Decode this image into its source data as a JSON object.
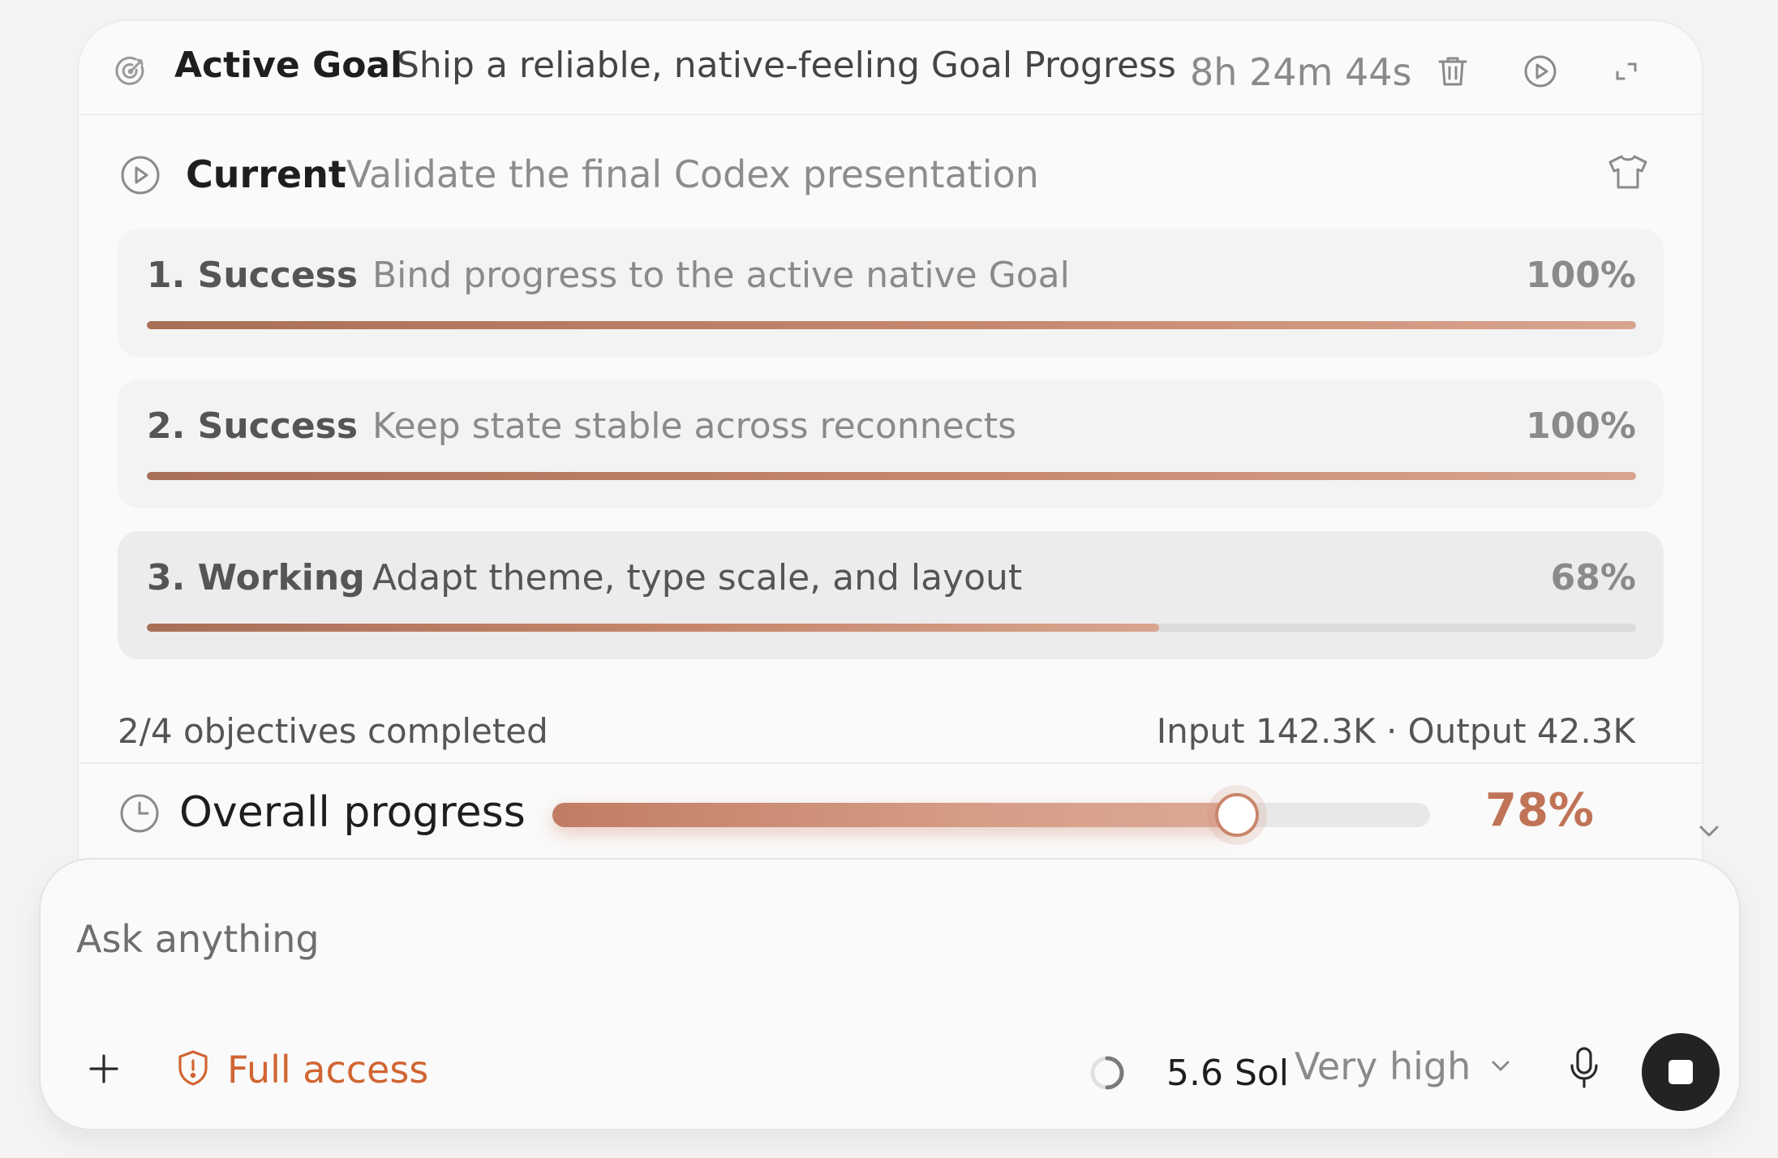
{
  "goal": {
    "title": "Active Goal",
    "text": "Ship a reliable, native-feeling Goal Progress",
    "timer": "8h 24m 44s",
    "icons": {
      "goal": "goal-target-icon",
      "delete": "trash-icon",
      "play": "play-circle-icon",
      "expand": "expand-icon"
    }
  },
  "current": {
    "label": "Current",
    "text": "Validate the final Codex presentation",
    "icon": "play-circle-icon",
    "theme_icon": "shirt-icon"
  },
  "objectives": [
    {
      "status": "1. Success",
      "text": "Bind progress to the active native Goal",
      "percent_label": "100%",
      "progress": 100
    },
    {
      "status": "2. Success",
      "text": "Keep state stable across reconnects",
      "percent_label": "100%",
      "progress": 100
    },
    {
      "status": "3. Working",
      "text": "Adapt theme, type scale, and layout",
      "percent_label": "68%",
      "progress": 68
    }
  ],
  "summary": {
    "completed": "2/4 objectives completed",
    "tokens": "Input 142.3K · Output 42.3K"
  },
  "overall": {
    "label": "Overall progress",
    "percent_label": "78%",
    "progress": 78,
    "icon": "clock-icon"
  },
  "composer": {
    "placeholder": "Ask anything",
    "access_label": "Full access",
    "model_label": "5.6 Sol",
    "effort_label": "Very high",
    "icons": {
      "add": "plus-icon",
      "access": "shield-alert-icon",
      "status": "spinner-icon",
      "effort": "chevron-down-icon",
      "mic": "microphone-icon",
      "stop": "stop-icon"
    }
  },
  "colors": {
    "accent": "#c07356",
    "access": "#d16532",
    "progress_start": "#a86f57",
    "progress_end": "#d8a58f",
    "stop_button": "#232323"
  }
}
